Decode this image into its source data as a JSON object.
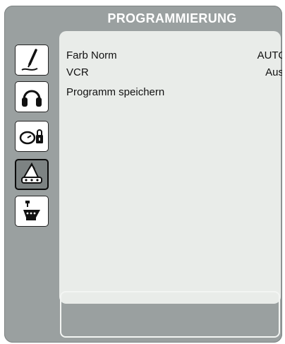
{
  "menu": {
    "title": "PROGRAMMIERUNG",
    "items": [
      {
        "label": "Farb Norm",
        "value": "AUTO"
      },
      {
        "label": "VCR",
        "value": "Aus"
      },
      {
        "label": "Programm speichern",
        "value": ""
      }
    ]
  },
  "tabs": [
    {
      "icon": "picture-settings-icon"
    },
    {
      "icon": "headphones-icon"
    },
    {
      "icon": "clock-lock-icon"
    },
    {
      "icon": "tuning-icon",
      "active": true
    },
    {
      "icon": "connection-icon"
    }
  ],
  "colors": {
    "panel": "#9aa0a0",
    "content": "#e9ece9",
    "title_text": "#ffffff"
  }
}
